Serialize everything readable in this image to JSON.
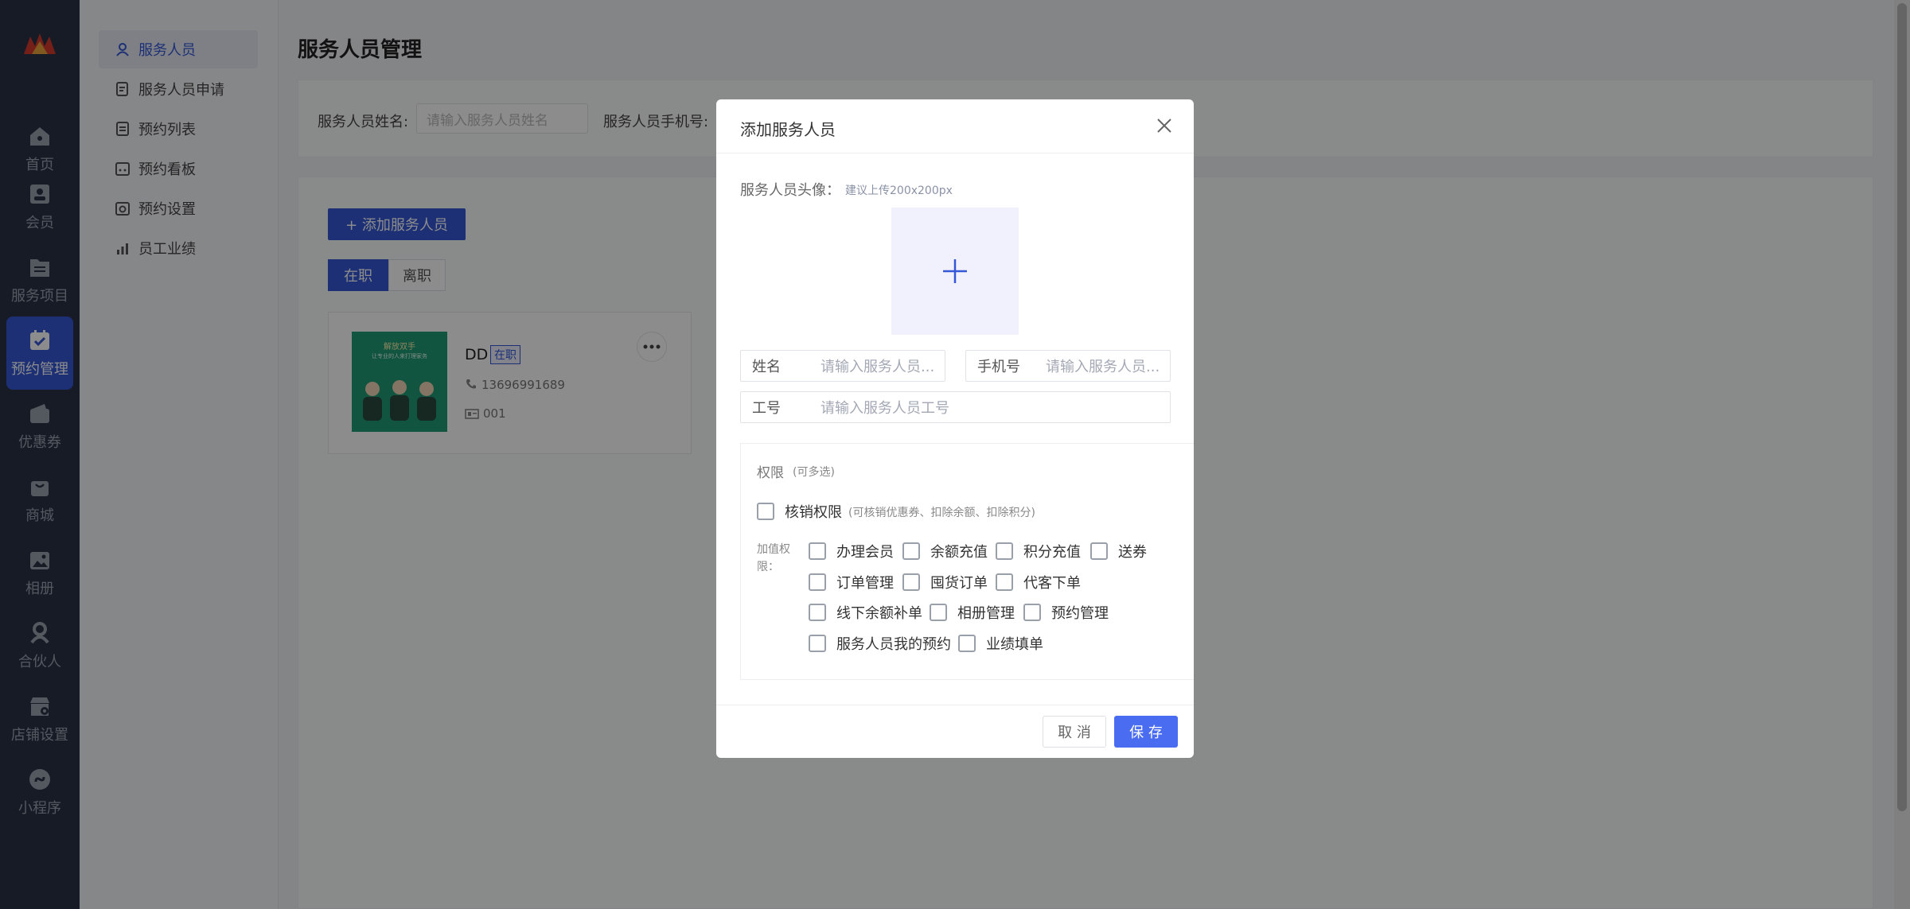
{
  "sidebar": {
    "items": [
      {
        "label": "首页",
        "icon": "home-icon"
      },
      {
        "label": "会员",
        "icon": "member-icon"
      },
      {
        "label": "服务项目",
        "icon": "folder-icon"
      },
      {
        "label": "预约管理",
        "icon": "calendar-icon",
        "active": true
      },
      {
        "label": "优惠券",
        "icon": "wallet-icon"
      },
      {
        "label": "商城",
        "icon": "shopping-bag-icon"
      },
      {
        "label": "相册",
        "icon": "image-icon"
      },
      {
        "label": "合伙人",
        "icon": "partner-icon"
      },
      {
        "label": "店铺设置",
        "icon": "store-icon"
      },
      {
        "label": "小程序",
        "icon": "miniprogram-icon"
      }
    ]
  },
  "subnav": {
    "items": [
      {
        "label": "服务人员",
        "icon": "user-icon",
        "active": true
      },
      {
        "label": "服务人员申请",
        "icon": "application-icon"
      },
      {
        "label": "预约列表",
        "icon": "list-icon"
      },
      {
        "label": "预约看板",
        "icon": "board-icon"
      },
      {
        "label": "预约设置",
        "icon": "settings-icon"
      },
      {
        "label": "员工业绩",
        "icon": "chart-icon"
      }
    ]
  },
  "page": {
    "title": "服务人员管理"
  },
  "filters": {
    "name_label": "服务人员姓名:",
    "name_placeholder": "请输入服务人员姓名",
    "phone_label": "服务人员手机号:"
  },
  "toolbar": {
    "add_label": "+ 添加服务人员"
  },
  "tabs": [
    {
      "label": "在职",
      "active": true
    },
    {
      "label": "离职"
    }
  ],
  "staff_card": {
    "name": "DD",
    "status": "在职",
    "phone": "13696991689",
    "id": "001",
    "photo_title": "解放双手",
    "photo_subtitle": "让专业的人来打理家务"
  },
  "modal": {
    "title": "添加服务人员",
    "avatar_label": "服务人员头像：",
    "avatar_hint": "建议上传200x200px",
    "name_label": "姓名",
    "name_placeholder": "请输入服务人员...",
    "phone_label": "手机号",
    "phone_placeholder": "请输入服务人员...",
    "id_label": "工号",
    "id_placeholder": "请输入服务人员工号",
    "perm_title": "权限",
    "perm_hint": "(可多选)",
    "verify_label": "核销权限",
    "verify_hint": "(可核销优惠券、扣除余额、扣除积分)",
    "extra_label": "加值权限：",
    "extra_perms": [
      "办理会员",
      "余额充值",
      "积分充值",
      "送券",
      "订单管理",
      "囤货订单",
      "代客下单",
      "线下余额补单",
      "相册管理",
      "预约管理",
      "服务人员我的预约",
      "业绩填单"
    ],
    "cancel_label": "取 消",
    "save_label": "保 存"
  },
  "colors": {
    "primary": "#3558d6",
    "sidebar": "#2a3245",
    "save": "#4a6cf0"
  }
}
